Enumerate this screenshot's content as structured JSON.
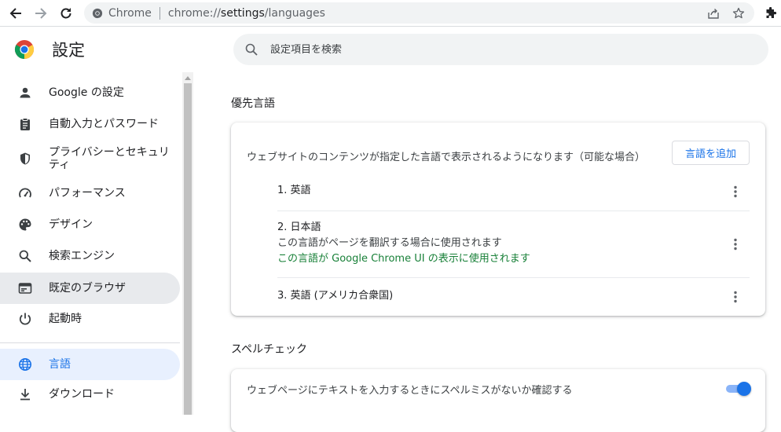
{
  "toolbar": {
    "back_icon": "arrow-left-icon",
    "forward_icon": "arrow-right-icon",
    "reload_icon": "reload-icon",
    "site_chip": "Chrome",
    "url_scheme": "chrome://",
    "url_host": "settings",
    "url_path": "/languages",
    "share_icon": "share-icon",
    "bookmark_icon": "star-icon",
    "extensions_icon": "puzzle-icon"
  },
  "header": {
    "title": "設定",
    "search_placeholder": "設定項目を検索"
  },
  "sidebar": {
    "items": [
      {
        "label": "Google の設定",
        "icon": "person-icon"
      },
      {
        "label": "自動入力とパスワード",
        "icon": "clipboard-icon"
      },
      {
        "label": "プライバシーとセキュリティ",
        "icon": "shield-icon"
      },
      {
        "label": "パフォーマンス",
        "icon": "speedometer-icon"
      },
      {
        "label": "デザイン",
        "icon": "palette-icon"
      },
      {
        "label": "検索エンジン",
        "icon": "search-icon"
      },
      {
        "label": "既定のブラウザ",
        "icon": "browser-icon"
      },
      {
        "label": "起動時",
        "icon": "power-icon"
      },
      {
        "label": "言語",
        "icon": "globe-icon"
      },
      {
        "label": "ダウンロード",
        "icon": "download-icon"
      }
    ]
  },
  "languages": {
    "section_title": "優先言語",
    "description": "ウェブサイトのコンテンツが指定した言語で表示されるようになります（可能な場合）",
    "add_button": "言語を追加",
    "list": [
      {
        "name": "1. 英語"
      },
      {
        "name": "2. 日本語",
        "note": "この言語がページを翻訳する場合に使用されます",
        "ui_note": "この言語が Google Chrome UI の表示に使用されます"
      },
      {
        "name": "3. 英語 (アメリカ合衆国)"
      }
    ]
  },
  "spellcheck": {
    "section_title": "スペルチェック",
    "label": "ウェブページにテキストを入力するときにスペルミスがないか確認する",
    "enabled": true
  },
  "colors": {
    "accent": "#1a73e8",
    "active_nav_bg": "#e8f0fe",
    "hover_nav_bg": "#e8eaed",
    "ui_note_green": "#188038"
  }
}
